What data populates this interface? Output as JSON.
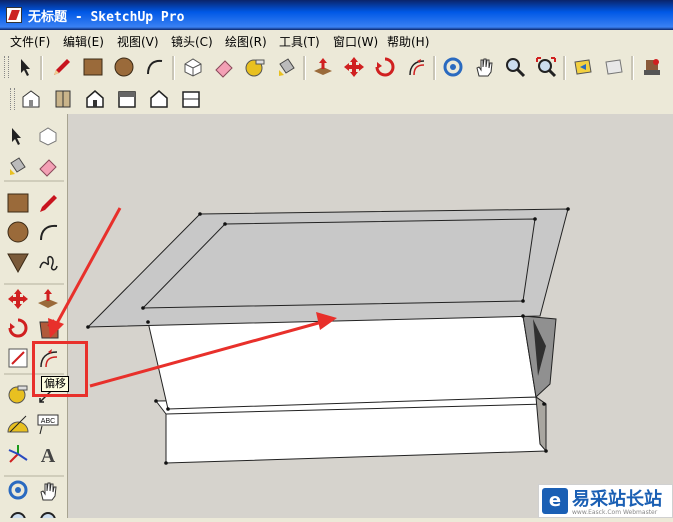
{
  "window": {
    "title": "无标题 - SketchUp Pro"
  },
  "menu": [
    {
      "label": "文件(F)"
    },
    {
      "label": "编辑(E)"
    },
    {
      "label": "视图(V)"
    },
    {
      "label": "镜头(C)"
    },
    {
      "label": "绘图(R)"
    },
    {
      "label": "工具(T)"
    },
    {
      "label": "窗口(W)"
    },
    {
      "label": "帮助(H)"
    }
  ],
  "toolbar_top": [
    "select-icon",
    "pencil-icon",
    "rectangle-icon",
    "circle-icon",
    "arc-icon",
    "make-component-icon",
    "eraser-icon",
    "tape-measure-icon",
    "paint-bucket-icon",
    "push-pull-icon",
    "move-icon",
    "rotate-icon",
    "offset-icon",
    "orbit-icon",
    "pan-icon",
    "zoom-icon",
    "zoom-extents-icon",
    "previous-view-icon",
    "next-view-icon",
    "warehouse-icon"
  ],
  "toolbar_views": [
    "iso-view-icon",
    "top-view-icon",
    "front-view-icon",
    "right-view-icon",
    "back-view-icon",
    "left-view-icon"
  ],
  "left_tools": [
    [
      "select-icon",
      "component-icon"
    ],
    [
      "paint-bucket-icon",
      "eraser-icon"
    ],
    [
      "rectangle-icon",
      "line-icon"
    ],
    [
      "circle-icon",
      "arc-icon"
    ],
    [
      "polygon-icon",
      "freehand-icon"
    ],
    [
      "move-icon",
      "push-pull-icon"
    ],
    [
      "rotate-icon",
      "follow-me-icon"
    ],
    [
      "scale-icon",
      "offset-icon"
    ],
    [
      "tape-measure-icon",
      "dimension-icon"
    ],
    [
      "protractor-icon",
      "text-icon"
    ],
    [
      "axes-icon",
      "3d-text-icon"
    ],
    [
      "orbit-icon",
      "pan-icon"
    ]
  ],
  "tooltip": {
    "text": "偏移"
  },
  "watermark": {
    "text": "易采站长站",
    "sub": "www.Easck.Com Webmaster"
  },
  "colors": {
    "title_bar": "#0058e6",
    "viewport_bg": "#d6d3cd",
    "annotation_red": "#e8302b"
  }
}
